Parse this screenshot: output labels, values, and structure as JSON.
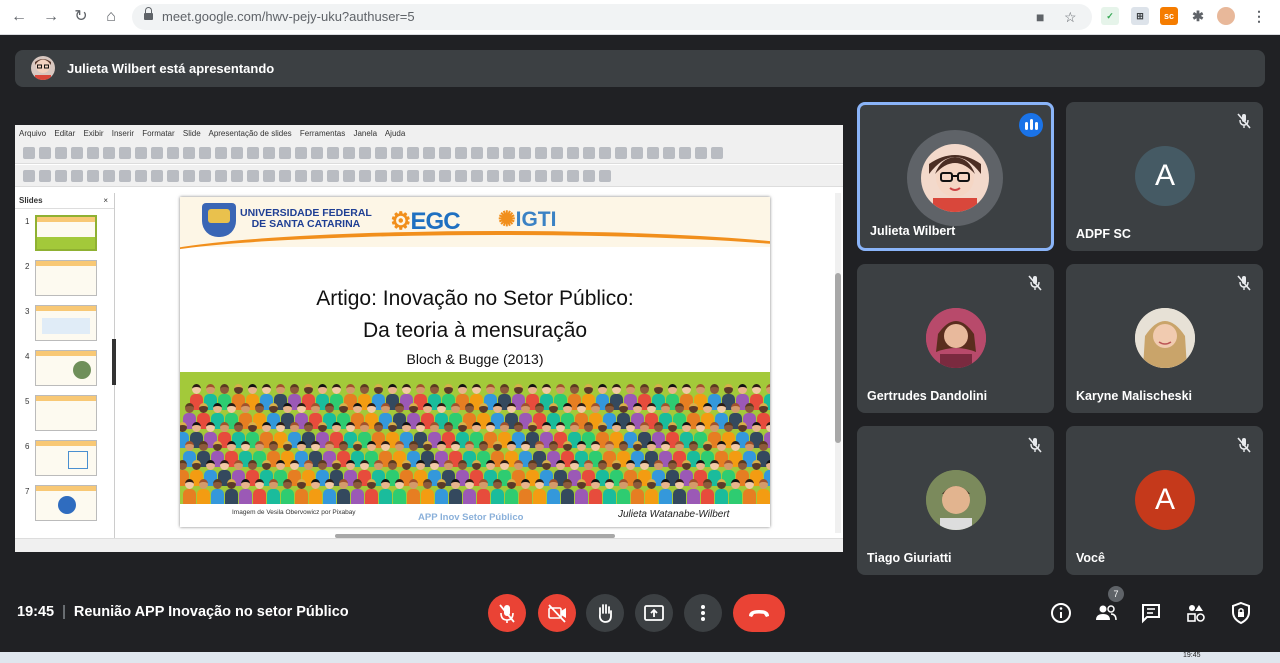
{
  "browser": {
    "url_host": "meet.google.com",
    "url_path": "/hwv-pejy-uku?authuser=5"
  },
  "banner": {
    "text": "Julieta Wilbert está apresentando"
  },
  "presentation": {
    "menu": [
      "Arquivo",
      "Editar",
      "Exibir",
      "Inserir",
      "Formatar",
      "Slide",
      "Apresentação de slides",
      "Ferramentas",
      "Janela",
      "Ajuda"
    ],
    "slides_pane_title": "Slides",
    "slides_pane_close": "×",
    "slide_numbers": [
      "1",
      "2",
      "3",
      "4",
      "5",
      "6",
      "7"
    ],
    "slide": {
      "institution_line1": "UNIVERSIDADE FEDERAL",
      "institution_line2": "DE SANTA CATARINA",
      "logo_egc": "EGC",
      "logo_igti": "IGTI",
      "title_line1": "Artigo: Inovação no Setor Público:",
      "title_line2": "Da teoria à mensuração",
      "subtitle": "Bloch & Bugge (2013)",
      "image_credit": "Imagem de Vesila Obervowicz por Pixabay",
      "footer_app": "APP Inov Setor Público",
      "footer_author": "Julieta Watanabe-Wilbert"
    }
  },
  "participants": [
    {
      "name": "Julieta Wilbert",
      "speaking": true
    },
    {
      "name": "ADPF SC",
      "initial": "A",
      "color": "#455a64",
      "muted": true
    },
    {
      "name": "Gertrudes Dandolini",
      "muted": true
    },
    {
      "name": "Karyne Malischeski",
      "muted": true
    },
    {
      "name": "Tiago Giuriatti",
      "muted": true
    },
    {
      "name": "Você",
      "initial": "A",
      "color": "#c5391b",
      "muted": true
    }
  ],
  "controls": {
    "time": "19:45",
    "meeting_name": "Reunião APP Inovação no setor Público",
    "people_count": "7"
  },
  "taskbar": {
    "clock": "19:45"
  },
  "colors": {
    "accent_red": "#ea4335",
    "active_border": "#8ab4f8",
    "speaking_blue": "#1a73e8"
  }
}
